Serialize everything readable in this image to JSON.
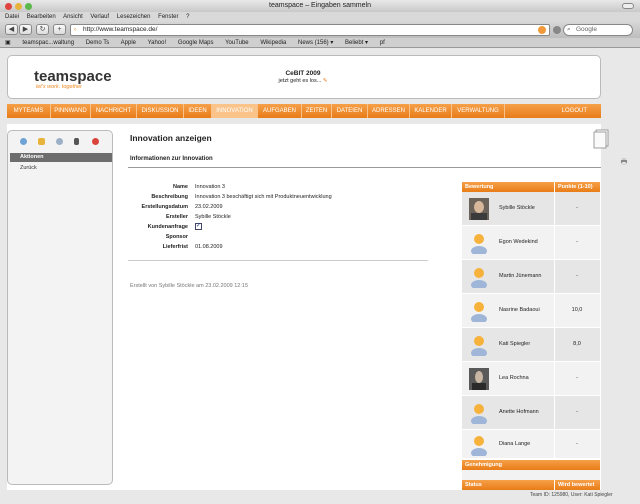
{
  "browser": {
    "window_title": "teamspace – Eingaben sammeln",
    "menu": [
      "Datei",
      "Bearbeiten",
      "Ansicht",
      "Verlauf",
      "Lesezeichen",
      "Fenster",
      "?"
    ],
    "url": "http://www.teamspace.de/",
    "search_placeholder": "Google",
    "bookmarks": [
      "teamspac...waltung",
      "Demo Ts",
      "Apple",
      "Yahoo!",
      "Google Maps",
      "YouTube",
      "Wikipedia",
      "News (156) ▾",
      "Beliebt ▾",
      "pf"
    ]
  },
  "header": {
    "logo": "teamspace",
    "logo_tagline": "let's work. together",
    "event_title": "CeBIT 2009",
    "event_sub": "jetzt geht es los..."
  },
  "nav": {
    "tabs": [
      "MYTEAMS",
      "PINNWAND",
      "NACHRICHT",
      "DISKUSSION",
      "IDEEN",
      "INNOVATION",
      "AUFGABEN",
      "ZEITEN",
      "DATEIEN",
      "ADRESSEN",
      "KALENDER",
      "VERWALTUNG"
    ],
    "active": "INNOVATION",
    "logout": "LOGOUT"
  },
  "sidebar": {
    "section": "Aktionen",
    "back": "Zurück"
  },
  "main": {
    "title": "Innovation anzeigen",
    "section": "Informationen zur Innovation",
    "fields": [
      {
        "label": "Name",
        "value": "Innovation 3"
      },
      {
        "label": "Beschreibung",
        "value": "Innovation 3 beschäftigt sich mit Produktneuentwicklung"
      },
      {
        "label": "Erstellungsdatum",
        "value": "23.02.2009"
      },
      {
        "label": "Ersteller",
        "value": "Sybille Stöckle"
      },
      {
        "label": "Kundenanfrage",
        "value": ""
      },
      {
        "label": "Sponsor",
        "value": ""
      },
      {
        "label": "Lieferfrist",
        "value": "01.08.2009"
      }
    ],
    "kundenanfrage_checked": true,
    "created_by": "Erstellt von Sybille Stöckle am 23.02.2009 12:15"
  },
  "rating": {
    "header_left": "Bewertung",
    "header_right": "Punkte (1-10)",
    "rows": [
      {
        "name": "Sybille Stöckle",
        "score": "-",
        "photo": true
      },
      {
        "name": "Egon Wedekind",
        "score": "-",
        "photo": false
      },
      {
        "name": "Martin Jünemann",
        "score": "-",
        "photo": false
      },
      {
        "name": "Nasrine Badaoui",
        "score": "10,0",
        "photo": false
      },
      {
        "name": "Kati Spiegler",
        "score": "8,0",
        "photo": false
      },
      {
        "name": "Lea Rochna",
        "score": "-",
        "photo": true
      },
      {
        "name": "Anette Hofmann",
        "score": "-",
        "photo": false
      },
      {
        "name": "Diana Lange",
        "score": "-",
        "photo": false
      }
    ],
    "approval_title": "Genehmigung",
    "status_label": "Status",
    "status_value": "Wird bewertet"
  },
  "footer": {
    "team_info": "Team ID: 125980, User: Kati Spiegler"
  }
}
